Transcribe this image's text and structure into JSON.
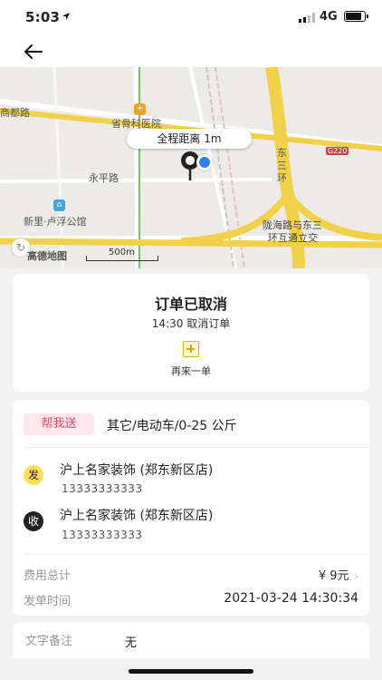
{
  "status_bar": {
    "time": "5:03",
    "network": "4G"
  },
  "map": {
    "labels": {
      "road_west": "商都路",
      "hospital": "省骨科医院",
      "yongping_road": "永平路",
      "apartment": "新里·卢浮公馆",
      "ring_vertical": "东三环",
      "interchange_line1": "陇海路与东三",
      "interchange_line2": "环互通立交",
      "road_badge": "G220"
    },
    "distance_text": "全程距离 1m",
    "logo": "高德地图",
    "scale": "500m"
  },
  "order_status": {
    "title": "订单已取消",
    "subtitle": "14:30 取消订单",
    "reorder_label": "再来一单"
  },
  "detail": {
    "service_tag": "帮我送",
    "service_desc": "其它/电动车/0-25 公斤",
    "sender": {
      "badge": "发",
      "name": "沪上名家装饰 (郑东新区店)",
      "phone": "13333333333"
    },
    "receiver": {
      "badge": "收",
      "name": "沪上名家装饰 (郑东新区店)",
      "phone": "13333333333"
    },
    "fee": {
      "label": "费用总计",
      "value": "¥ 9元"
    },
    "order_time": {
      "label": "发单时间",
      "value": "2021-03-24 14:30:34"
    }
  },
  "note": {
    "label": "文字备注",
    "value": "无"
  },
  "colors": {
    "accent_pink": "#e84a6a",
    "accent_yellow": "#ffe14d",
    "location_blue": "#2f80ed"
  }
}
